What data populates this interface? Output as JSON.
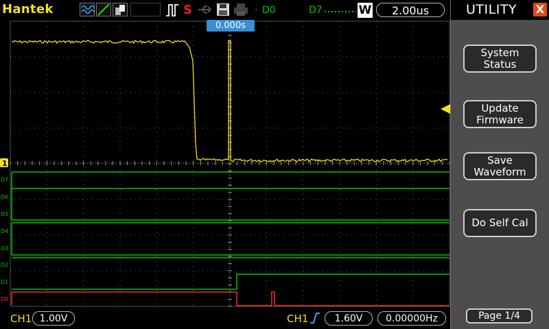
{
  "header": {
    "brand": "Hantek",
    "d0_label": "D0",
    "d7_label": "D7",
    "w_label": "W",
    "timebase": "2.00us",
    "trigger_position": "0.000s"
  },
  "panel": {
    "title": "UTILITY",
    "close": "X",
    "buttons": [
      "System\nStatus",
      "Update\nFirmware",
      "Save\nWaveform",
      "Do Self Cal"
    ],
    "page": "Page 1/4"
  },
  "channel_labels": [
    "D7",
    "D6",
    "D5",
    "D4",
    "D3",
    "D2",
    "D1",
    "D0"
  ],
  "ch1_marker": "1",
  "footer": {
    "ch1_label": "CH1",
    "ch1_scale": "1.00V",
    "trig_source": "CH1",
    "trig_level": "1.60V",
    "frequency": "0.00000Hz"
  },
  "colors": {
    "analog": "#f5e11e",
    "digital": "#00c800",
    "d0": "#ff2a2a",
    "accent_blue": "#3a8ed6"
  },
  "icons": [
    "wave-mode-icon",
    "ramp-icon",
    "persist-icon",
    "trigger-pulse-icon",
    "stop-icon",
    "usb-icon",
    "save-disk-icon",
    "printer-icon",
    "marker-icon"
  ]
}
